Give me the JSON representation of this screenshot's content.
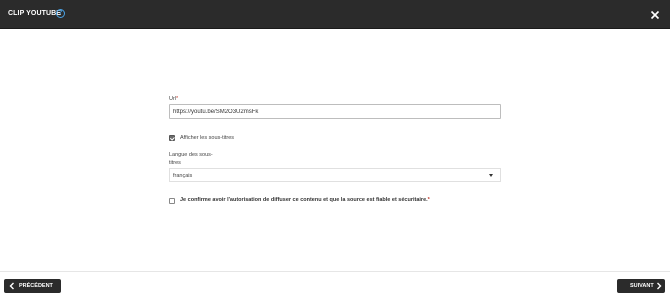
{
  "header": {
    "title": "CLIP YOUTUBE",
    "help_icon": "question-circle-icon",
    "close_icon": "close-icon"
  },
  "form": {
    "url_label": "Url",
    "required_mark": "*",
    "url_value": "https://youtu.be/SM2O3U2msFk",
    "show_subtitles_label": "Afficher les sous-titres",
    "show_subtitles_checked": true,
    "subtitle_language_label_line1": "Langue des sous-",
    "subtitle_language_label_line2": "titres",
    "subtitle_language_value": "français",
    "confirm_label": "Je confirme avoir l'autorisation de diffuser ce contenu et que la source est fiable et sécuritaire.",
    "confirm_checked": false
  },
  "footer": {
    "prev_label": "PRÉCÉDENT",
    "next_label": "SUIVANT"
  },
  "colors": {
    "header_bg": "#2b2b2b",
    "accent": "#4aa3e6",
    "required": "#c0392b",
    "button_bg": "#2b2b2b"
  }
}
